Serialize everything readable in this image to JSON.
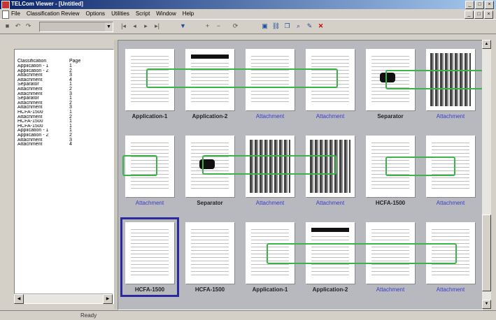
{
  "window": {
    "title": "TELCom Viewer - [Untitled]"
  },
  "menu": [
    "File",
    "Classification Review",
    "Options",
    "Utilities",
    "Script",
    "Window",
    "Help"
  ],
  "toolbar": {
    "icons": [
      "save-icon",
      "undo-icon",
      "redo-icon",
      "filter-icon",
      "scan-icon",
      "link-icon",
      "copy-icon",
      "search-icon",
      "edit-icon",
      "delete-icon"
    ]
  },
  "classification_list": {
    "headers": [
      "Classification",
      "Page"
    ],
    "rows": [
      [
        "Application - 1",
        "1"
      ],
      [
        "Application - 2",
        "2"
      ],
      [
        "Attachment",
        "3"
      ],
      [
        "Attachment",
        "4"
      ],
      [
        "Separator",
        "1"
      ],
      [
        "Attachment",
        "2"
      ],
      [
        "Attachment",
        "3"
      ],
      [
        "Separator",
        "1"
      ],
      [
        "Attachment",
        "2"
      ],
      [
        "Attachment",
        "3"
      ],
      [
        "HCFA-1500",
        "1"
      ],
      [
        "Attachment",
        "2"
      ],
      [
        "HCFA-1500",
        "1"
      ],
      [
        "HCFA-1500",
        "1"
      ],
      [
        "Application - 1",
        "1"
      ],
      [
        "Application - 2",
        "2"
      ],
      [
        "Attachment",
        "3"
      ],
      [
        "Attachment",
        "4"
      ]
    ]
  },
  "thumbnails": [
    "Application-1",
    "Application-2",
    "Attachment",
    "Attachment",
    "Separator",
    "Attachment",
    "Attachment",
    "Separator",
    "Attachment",
    "Attachment",
    "HCFA-1500",
    "Attachment",
    "HCFA-1500",
    "HCFA-1500",
    "Application-1",
    "Application-2",
    "Attachment",
    "Attachment"
  ],
  "status": {
    "text": "Ready"
  },
  "colors": {
    "selection": "#2a2a9a",
    "group_highlight": "#3bb24a",
    "attachment_label": "#3a3acc"
  }
}
